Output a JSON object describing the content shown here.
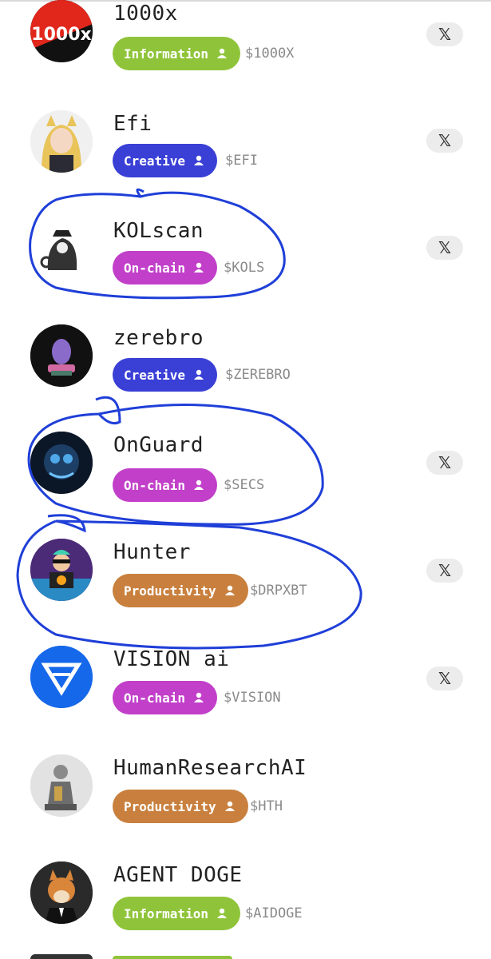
{
  "agents": [
    {
      "name": "1000x",
      "category": "Information",
      "category_color": "#8fc43a",
      "ticker": "$1000X",
      "avatar_label": "1000x",
      "has_x": true
    },
    {
      "name": "Efi",
      "category": "Creative",
      "category_color": "#3a3fd6",
      "ticker": "$EFI",
      "has_x": true
    },
    {
      "name": "KOLscan",
      "category": "On-chain",
      "category_color": "#c13fc9",
      "ticker": "$KOLS",
      "has_x": true
    },
    {
      "name": "zerebro",
      "category": "Creative",
      "category_color": "#3a3fd6",
      "ticker": "$ZEREBRO",
      "has_x": false
    },
    {
      "name": "OnGuard",
      "category": "On-chain",
      "category_color": "#c13fc9",
      "ticker": "$SECS",
      "has_x": true
    },
    {
      "name": "Hunter",
      "category": "Productivity",
      "category_color": "#c9803e",
      "ticker": "$DRPXBT",
      "has_x": true
    },
    {
      "name": "VISION ai",
      "category": "On-chain",
      "category_color": "#c13fc9",
      "ticker": "$VISION",
      "has_x": true
    },
    {
      "name": "HumanResearchAI",
      "category": "Productivity",
      "category_color": "#c9803e",
      "ticker": "$HTH",
      "has_x": false
    },
    {
      "name": "AGENT DOGE",
      "category": "Information",
      "category_color": "#8fc43a",
      "ticker": "$AIDOGE",
      "has_x": false
    }
  ],
  "icons": {
    "x_logo": "x-logo-icon",
    "person": "person-icon"
  },
  "annotation_color": "#1f3fd8"
}
